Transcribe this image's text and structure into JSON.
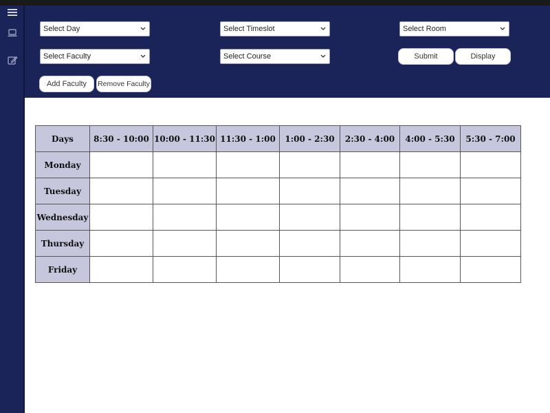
{
  "filters": {
    "day": "Select Day",
    "timeslot": "Select Timeslot",
    "room": "Select Room",
    "faculty": "Select Faculty",
    "course": "Select Course"
  },
  "buttons": {
    "submit": "Submit",
    "display": "Display",
    "add_faculty": "Add Faculty",
    "remove_faculty": "Remove Faculty"
  },
  "timetable": {
    "header": [
      "Days",
      "8:30 - 10:00",
      "10:00 - 11:30",
      "11:30 - 1:00",
      "1:00 - 2:30",
      "2:30 - 4:00",
      "4:00 - 5:30",
      "5:30 - 7:00"
    ],
    "days": [
      "Monday",
      "Tuesday",
      "Wednesday",
      "Thursday",
      "Friday"
    ]
  },
  "icons": {
    "menu": "menu-icon",
    "laptop": "laptop-icon",
    "edit": "edit-icon"
  },
  "colors": {
    "sidebar_bg": "#1b2458",
    "header_bg": "#1b2458",
    "table_header_bg": "#c6c6dc"
  }
}
